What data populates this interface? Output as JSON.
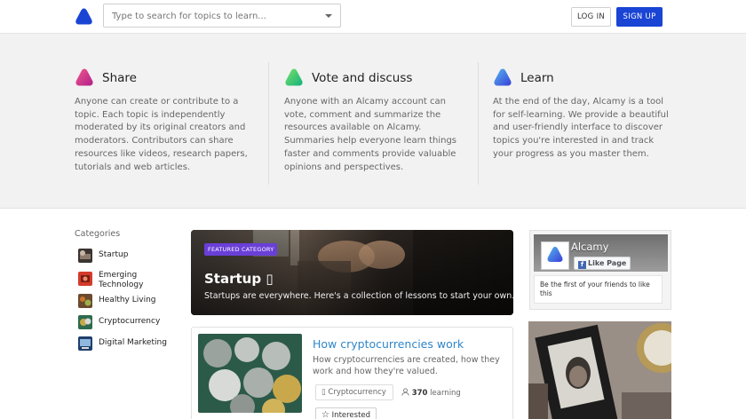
{
  "header": {
    "search_placeholder": "Type to search for topics to learn...",
    "login_label": "LOG IN",
    "signup_label": "SIGN UP"
  },
  "colors": {
    "brand_blue": "#1a44d4",
    "feature_badge": "#6a3fd8",
    "link_blue": "#2f86c9"
  },
  "features": [
    {
      "title": "Share",
      "icon": "share-gradient-logo-icon",
      "text": "Anyone can create or contribute to a topic. Each topic is independently moderated by its original creators and moderators. Contributors can share resources like videos, research papers, tutorials and web articles."
    },
    {
      "title": "Vote and discuss",
      "icon": "vote-gradient-logo-icon",
      "text": "Anyone with an Alcamy account can vote, comment and summarize the resources available on Alcamy. Summaries help everyone learn things faster and comments provide valuable opinions and perspectives."
    },
    {
      "title": "Learn",
      "icon": "learn-gradient-logo-icon",
      "text": "At the end of the day, Alcamy is a tool for self-learning. We provide a beautiful and user-friendly interface to discover topics you're interested in and track your progress as you master them."
    }
  ],
  "categories": {
    "title": "Categories",
    "items": [
      {
        "label": "Startup"
      },
      {
        "label": "Emerging Technology"
      },
      {
        "label": "Healthy Living"
      },
      {
        "label": "Cryptocurrency"
      },
      {
        "label": "Digital Marketing"
      }
    ]
  },
  "featured": {
    "badge": "FEATURED CATEGORY",
    "title": "Startup",
    "icon_glyph": "▯",
    "subtitle": "Startups are everywhere. Here's a collection of lessons to start your own."
  },
  "topic_card": {
    "title": "How cryptocurrencies work",
    "description": "How cryptocurrencies are created, how they work and how they're valued.",
    "tag_icon_glyph": "▯",
    "tag": "Cryptocurrency",
    "learning_count": "370",
    "learning_label": "learning",
    "interested_label": "Interested"
  },
  "facebook": {
    "page_name": "Alcamy",
    "like_label": "Like Page",
    "friends_text": "Be the first of your friends to like this"
  }
}
